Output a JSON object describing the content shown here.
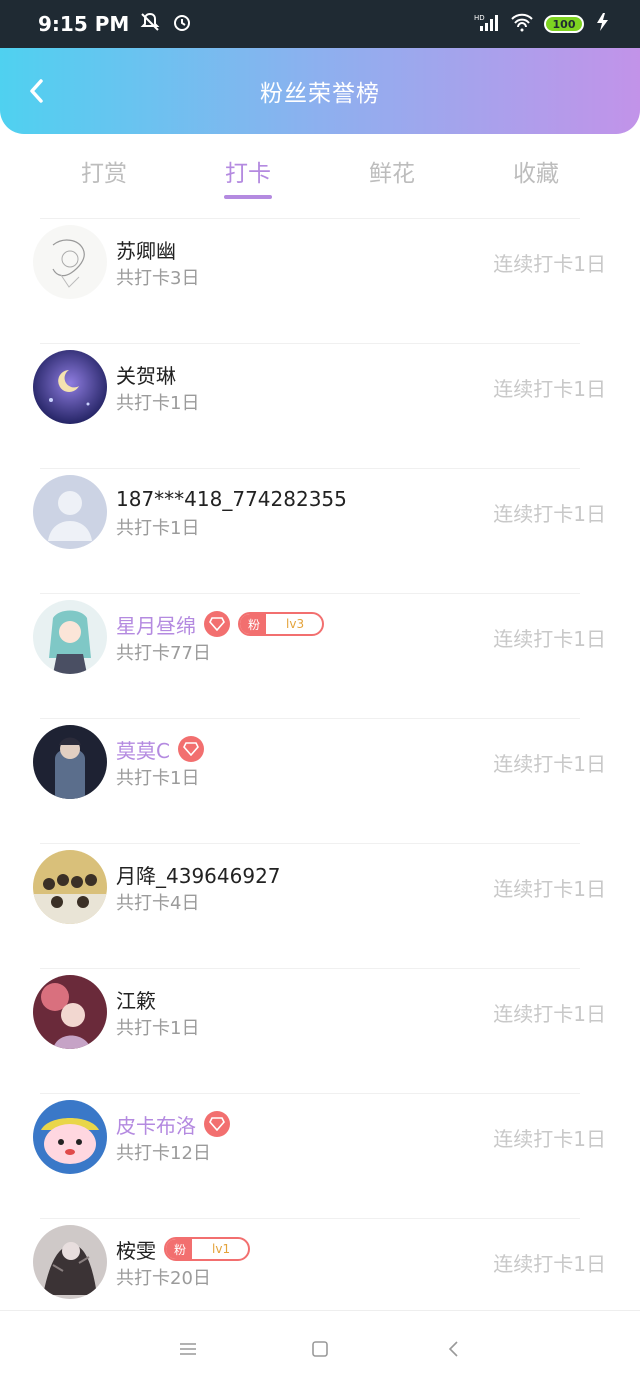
{
  "status": {
    "time": "9:15 PM",
    "battery": "100",
    "signal_label": "HD"
  },
  "header": {
    "title": "粉丝荣誉榜"
  },
  "tabs": [
    {
      "label": "打赏",
      "active": false
    },
    {
      "label": "打卡",
      "active": true
    },
    {
      "label": "鲜花",
      "active": false
    },
    {
      "label": "收藏",
      "active": false
    }
  ],
  "fans": [
    {
      "name": "苏卿幽",
      "total": "共打卡3日",
      "streak": "连续打卡1日",
      "vip": false,
      "gem": false,
      "badge": null
    },
    {
      "name": "关贺琳",
      "total": "共打卡1日",
      "streak": "连续打卡1日",
      "vip": false,
      "gem": false,
      "badge": null
    },
    {
      "name": "187***418_774282355",
      "total": "共打卡1日",
      "streak": "连续打卡1日",
      "vip": false,
      "gem": false,
      "badge": null
    },
    {
      "name": "星月昼绵",
      "total": "共打卡77日",
      "streak": "连续打卡1日",
      "vip": true,
      "gem": true,
      "badge": {
        "left": "粉",
        "right": "lv3"
      }
    },
    {
      "name": "莫莫C",
      "total": "共打卡1日",
      "streak": "连续打卡1日",
      "vip": true,
      "gem": true,
      "badge": null
    },
    {
      "name": "月降_439646927",
      "total": "共打卡4日",
      "streak": "连续打卡1日",
      "vip": false,
      "gem": false,
      "badge": null
    },
    {
      "name": "江簌",
      "total": "共打卡1日",
      "streak": "连续打卡1日",
      "vip": false,
      "gem": false,
      "badge": null
    },
    {
      "name": "皮卡布洛",
      "total": "共打卡12日",
      "streak": "连续打卡1日",
      "vip": true,
      "gem": true,
      "badge": null
    },
    {
      "name": "桉雯",
      "total": "共打卡20日",
      "streak": "连续打卡1日",
      "vip": false,
      "gem": false,
      "badge": {
        "left": "粉",
        "right": "lv1"
      }
    }
  ],
  "colors": {
    "accent": "#b48ae0",
    "badge": "#f26f6f",
    "muted": "#c8c8c8"
  }
}
